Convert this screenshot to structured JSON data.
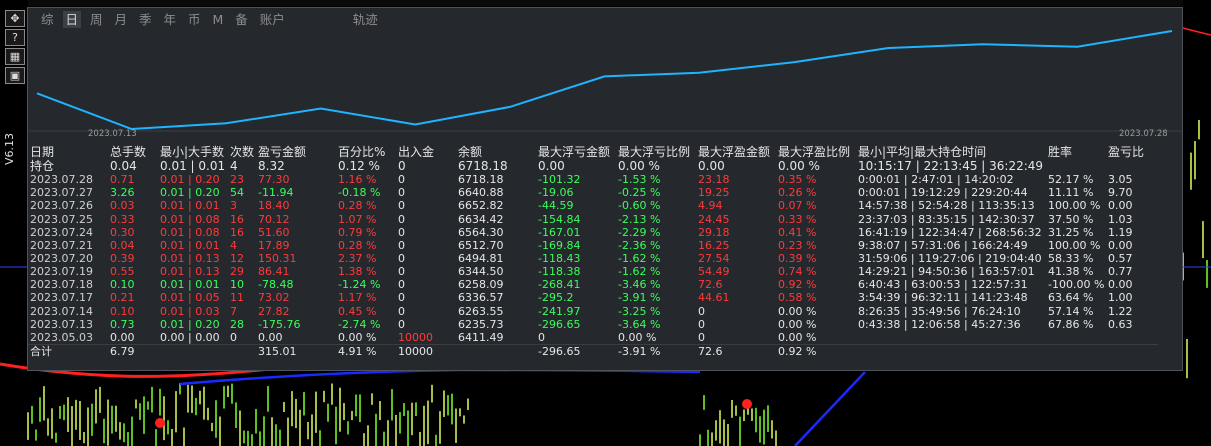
{
  "colors": {
    "up": "#ff3a3a",
    "down": "#3aff5a",
    "line": "#1eb4ff"
  },
  "left_toolbar": [
    {
      "name": "move-icon",
      "glyph": "✥"
    },
    {
      "name": "help-icon",
      "glyph": "?"
    },
    {
      "name": "grid-icon",
      "glyph": "▦"
    },
    {
      "name": "window-icon",
      "glyph": "▣"
    }
  ],
  "left_version": "V6.13",
  "tabs": [
    "综",
    "日",
    "周",
    "月",
    "季",
    "年",
    "币",
    "M",
    "备",
    "账户"
  ],
  "track_tab": "轨迹",
  "active_tab": "日",
  "chart": {
    "x_start": "2023.07.13",
    "x_end": "2023.07.28",
    "series": [
      6411.49,
      6235.73,
      6263.55,
      6336.57,
      6258.09,
      6344.5,
      6494.81,
      6512.7,
      6564.3,
      6634.42,
      6652.82,
      6640.88,
      6718.18
    ]
  },
  "table": {
    "headers": [
      "日期",
      "总手数",
      "最小|大手数",
      "次数",
      "盈亏金额",
      "百分比%",
      "出入金",
      "余额",
      "最大浮亏金额",
      "最大浮亏比例",
      "最大浮盈金额",
      "最大浮盈比例",
      "最小|平均|最大持仓时间",
      "胜率",
      "盈亏比"
    ],
    "holding": {
      "label": "持仓",
      "lots": "0.04",
      "minmax": "0.01 | 0.01",
      "count": "4",
      "pnl": "8.32",
      "pct": "0.12 %",
      "io": "0",
      "bal": "6718.18",
      "mfl": "0.00",
      "mflp": "0.00 %",
      "mfp": "0.00",
      "mfpp": "0.00 %",
      "time": "10:15:17 | 22:13:45 | 36:22:49",
      "win": "",
      "ratio": ""
    },
    "rows": [
      {
        "date": "2023.07.28",
        "lots": "0.71",
        "minmax": "0.01 | 0.20",
        "count": "23",
        "pnl": "77.30",
        "pct": "1.16 %",
        "io": "0",
        "bal": "6718.18",
        "mfl": "-101.32",
        "mflp": "-1.53 %",
        "mfp": "23.18",
        "mfpp": "0.35 %",
        "time": "0:00:01 | 2:47:01 | 14:20:02",
        "win": "52.17 %",
        "ratio": "3.05",
        "dir": "up"
      },
      {
        "date": "2023.07.27",
        "lots": "3.26",
        "minmax": "0.01 | 0.20",
        "count": "54",
        "pnl": "-11.94",
        "pct": "-0.18 %",
        "io": "0",
        "bal": "6640.88",
        "mfl": "-19.06",
        "mflp": "-0.25 %",
        "mfp": "19.25",
        "mfpp": "0.26 %",
        "time": "0:00:01 | 19:12:29 | 229:20:44",
        "win": "11.11 %",
        "ratio": "9.70",
        "dir": "down"
      },
      {
        "date": "2023.07.26",
        "lots": "0.03",
        "minmax": "0.01 | 0.01",
        "count": "3",
        "pnl": "18.40",
        "pct": "0.28 %",
        "io": "0",
        "bal": "6652.82",
        "mfl": "-44.59",
        "mflp": "-0.60 %",
        "mfp": "4.94",
        "mfpp": "0.07 %",
        "time": "14:57:38 | 52:54:28 | 113:35:13",
        "win": "100.00 %",
        "ratio": "0.00",
        "dir": "up"
      },
      {
        "date": "2023.07.25",
        "lots": "0.33",
        "minmax": "0.01 | 0.08",
        "count": "16",
        "pnl": "70.12",
        "pct": "1.07 %",
        "io": "0",
        "bal": "6634.42",
        "mfl": "-154.84",
        "mflp": "-2.13 %",
        "mfp": "24.45",
        "mfpp": "0.33 %",
        "time": "23:37:03 | 83:35:15 | 142:30:37",
        "win": "37.50 %",
        "ratio": "1.03",
        "dir": "up"
      },
      {
        "date": "2023.07.24",
        "lots": "0.30",
        "minmax": "0.01 | 0.08",
        "count": "16",
        "pnl": "51.60",
        "pct": "0.79 %",
        "io": "0",
        "bal": "6564.30",
        "mfl": "-167.01",
        "mflp": "-2.29 %",
        "mfp": "29.18",
        "mfpp": "0.41 %",
        "time": "16:41:19 | 122:34:47 | 268:56:32",
        "win": "31.25 %",
        "ratio": "1.19",
        "dir": "up"
      },
      {
        "date": "2023.07.21",
        "lots": "0.04",
        "minmax": "0.01 | 0.01",
        "count": "4",
        "pnl": "17.89",
        "pct": "0.28 %",
        "io": "0",
        "bal": "6512.70",
        "mfl": "-169.84",
        "mflp": "-2.36 %",
        "mfp": "16.25",
        "mfpp": "0.23 %",
        "time": "9:38:07 | 57:31:06 | 166:24:49",
        "win": "100.00 %",
        "ratio": "0.00",
        "dir": "up"
      },
      {
        "date": "2023.07.20",
        "lots": "0.39",
        "minmax": "0.01 | 0.13",
        "count": "12",
        "pnl": "150.31",
        "pct": "2.37 %",
        "io": "0",
        "bal": "6494.81",
        "mfl": "-118.43",
        "mflp": "-1.62 %",
        "mfp": "27.54",
        "mfpp": "0.39 %",
        "time": "31:59:06 | 119:27:06 | 219:04:40",
        "win": "58.33 %",
        "ratio": "0.57",
        "dir": "up"
      },
      {
        "date": "2023.07.19",
        "lots": "0.55",
        "minmax": "0.01 | 0.13",
        "count": "29",
        "pnl": "86.41",
        "pct": "1.38 %",
        "io": "0",
        "bal": "6344.50",
        "mfl": "-118.38",
        "mflp": "-1.62 %",
        "mfp": "54.49",
        "mfpp": "0.74 %",
        "time": "14:29:21 | 94:50:36 | 163:57:01",
        "win": "41.38 %",
        "ratio": "0.77",
        "dir": "up"
      },
      {
        "date": "2023.07.18",
        "lots": "0.10",
        "minmax": "0.01 | 0.01",
        "count": "10",
        "pnl": "-78.48",
        "pct": "-1.24 %",
        "io": "0",
        "bal": "6258.09",
        "mfl": "-268.41",
        "mflp": "-3.46 %",
        "mfp": "72.6",
        "mfpp": "0.92 %",
        "time": "6:40:43 | 63:00:53 | 122:57:31",
        "win": "-100.00 %",
        "ratio": "0.00",
        "dir": "down"
      },
      {
        "date": "2023.07.17",
        "lots": "0.21",
        "minmax": "0.01 | 0.05",
        "count": "11",
        "pnl": "73.02",
        "pct": "1.17 %",
        "io": "0",
        "bal": "6336.57",
        "mfl": "-295.2",
        "mflp": "-3.91 %",
        "mfp": "44.61",
        "mfpp": "0.58 %",
        "time": "3:54:39 | 96:32:11 | 141:23:48",
        "win": "63.64 %",
        "ratio": "1.00",
        "dir": "up"
      },
      {
        "date": "2023.07.14",
        "lots": "0.10",
        "minmax": "0.01 | 0.03",
        "count": "7",
        "pnl": "27.82",
        "pct": "0.45 %",
        "io": "0",
        "bal": "6263.55",
        "mfl": "-241.97",
        "mflp": "-3.25 %",
        "mfp": "0",
        "mfpp": "0.00 %",
        "time": "8:26:35 | 35:49:56 | 76:24:10",
        "win": "57.14 %",
        "ratio": "1.22",
        "dir": "up"
      },
      {
        "date": "2023.07.13",
        "lots": "0.73",
        "minmax": "0.01 | 0.20",
        "count": "28",
        "pnl": "-175.76",
        "pct": "-2.74 %",
        "io": "0",
        "bal": "6235.73",
        "mfl": "-296.65",
        "mflp": "-3.64 %",
        "mfp": "0",
        "mfpp": "0.00 %",
        "time": "0:43:38 | 12:06:58 | 45:27:36",
        "win": "67.86 %",
        "ratio": "0.63",
        "dir": "down"
      },
      {
        "date": "2023.05.03",
        "lots": "0.00",
        "minmax": "0.00 | 0.00",
        "count": "0",
        "pnl": "0.00",
        "pct": "0.00 %",
        "io": "10000",
        "bal": "6411.49",
        "mfl": "0",
        "mflp": "0.00 %",
        "mfp": "0",
        "mfpp": "0.00 %",
        "time": "",
        "win": "",
        "ratio": "",
        "dir": "flat"
      }
    ],
    "total": {
      "label": "合计",
      "lots": "6.79",
      "pnl": "315.01",
      "pct": "4.91 %",
      "io": "10000",
      "mfl": "-296.65",
      "mflp": "-3.91 %",
      "mfp": "72.6",
      "mfpp": "0.92 %"
    }
  }
}
